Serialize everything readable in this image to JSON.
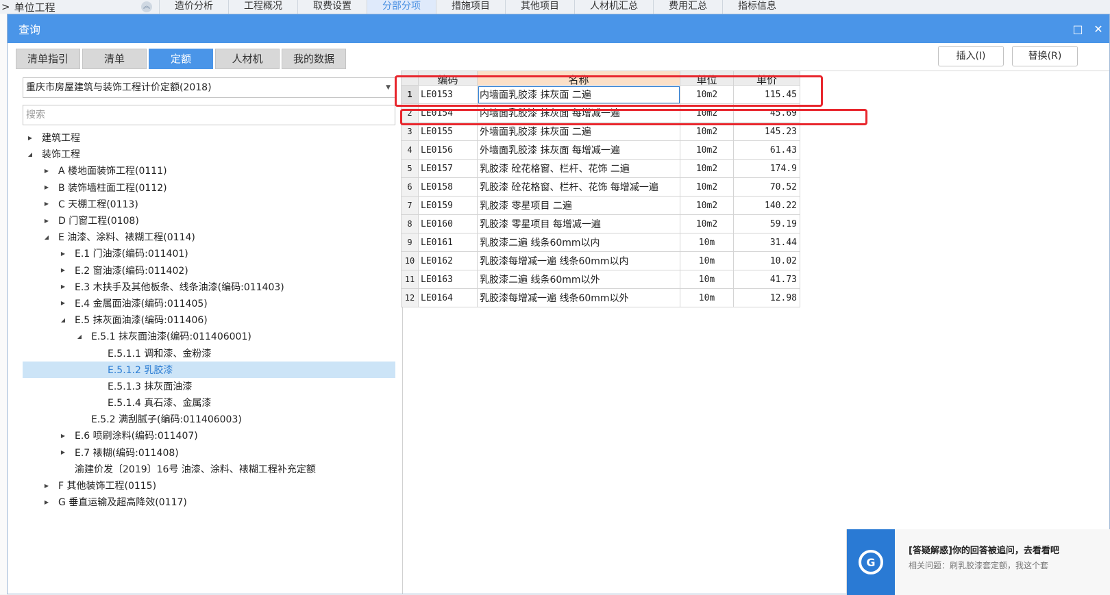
{
  "background": {
    "breadcrumb": "单位工程",
    "crumb_prefix": "> ",
    "tabs": [
      "造价分析",
      "工程概况",
      "取费设置",
      "分部分项",
      "措施项目",
      "其他项目",
      "人材机汇总",
      "费用汇总",
      "指标信息"
    ],
    "active_tab": "分部分项"
  },
  "dialog": {
    "title": "查询",
    "tabs": [
      "清单指引",
      "清单",
      "定额",
      "人材机",
      "我的数据"
    ],
    "active_tab": "定额",
    "insert_label": "插入(I)",
    "replace_label": "替换(R)"
  },
  "left": {
    "quota_lib": "重庆市房屋建筑与装饰工程计价定额(2018)",
    "search_placeholder": "搜索",
    "tree": [
      {
        "label": "建筑工程",
        "level": 0,
        "toggle": "collapsed"
      },
      {
        "label": "装饰工程",
        "level": 0,
        "toggle": "expanded"
      },
      {
        "label": "A 楼地面装饰工程(0111)",
        "level": 1,
        "toggle": "collapsed"
      },
      {
        "label": "B 装饰墙柱面工程(0112)",
        "level": 1,
        "toggle": "collapsed"
      },
      {
        "label": "C 天棚工程(0113)",
        "level": 1,
        "toggle": "collapsed"
      },
      {
        "label": "D 门窗工程(0108)",
        "level": 1,
        "toggle": "collapsed"
      },
      {
        "label": "E 油漆、涂料、裱糊工程(0114)",
        "level": 1,
        "toggle": "expanded"
      },
      {
        "label": "E.1 门油漆(编码:011401)",
        "level": 2,
        "toggle": "collapsed"
      },
      {
        "label": "E.2 窗油漆(编码:011402)",
        "level": 2,
        "toggle": "collapsed"
      },
      {
        "label": "E.3 木扶手及其他板条、线条油漆(编码:011403)",
        "level": 2,
        "toggle": "collapsed"
      },
      {
        "label": "E.4 金属面油漆(编码:011405)",
        "level": 2,
        "toggle": "collapsed"
      },
      {
        "label": "E.5 抹灰面油漆(编码:011406)",
        "level": 2,
        "toggle": "expanded"
      },
      {
        "label": "E.5.1 抹灰面油漆(编码:011406001)",
        "level": 3,
        "toggle": "expanded"
      },
      {
        "label": "E.5.1.1 调和漆、金粉漆",
        "level": 4,
        "toggle": "none"
      },
      {
        "label": "E.5.1.2 乳胶漆",
        "level": 4,
        "toggle": "none",
        "selected": true
      },
      {
        "label": "E.5.1.3 抹灰面油漆",
        "level": 4,
        "toggle": "none"
      },
      {
        "label": "E.5.1.4 真石漆、金属漆",
        "level": 4,
        "toggle": "none"
      },
      {
        "label": "E.5.2 满刮腻子(编码:011406003)",
        "level": 3,
        "toggle": "none"
      },
      {
        "label": "E.6 喷刷涂料(编码:011407)",
        "level": 2,
        "toggle": "collapsed"
      },
      {
        "label": "E.7 裱糊(编码:011408)",
        "level": 2,
        "toggle": "collapsed"
      },
      {
        "label": "渝建价发〔2019〕16号 油漆、涂料、裱糊工程补充定额",
        "level": 2,
        "toggle": "none"
      },
      {
        "label": "F 其他装饰工程(0115)",
        "level": 1,
        "toggle": "collapsed"
      },
      {
        "label": "G 垂直运输及超高降效(0117)",
        "level": 1,
        "toggle": "collapsed"
      }
    ]
  },
  "grid": {
    "headers": {
      "code": "编码",
      "name": "名称",
      "unit": "单位",
      "price": "单价"
    },
    "rows": [
      {
        "idx": "1",
        "code": "LE0153",
        "name": "内墙面乳胶漆 抹灰面 二遍",
        "unit": "10m2",
        "price": "115.45"
      },
      {
        "idx": "2",
        "code": "LE0154",
        "name": "内墙面乳胶漆 抹灰面 每增减一遍",
        "unit": "10m2",
        "price": "45.69"
      },
      {
        "idx": "3",
        "code": "LE0155",
        "name": "外墙面乳胶漆 抹灰面 二遍",
        "unit": "10m2",
        "price": "145.23"
      },
      {
        "idx": "4",
        "code": "LE0156",
        "name": "外墙面乳胶漆 抹灰面 每增减一遍",
        "unit": "10m2",
        "price": "61.43"
      },
      {
        "idx": "5",
        "code": "LE0157",
        "name": "乳胶漆 砼花格窗、栏杆、花饰 二遍",
        "unit": "10m2",
        "price": "174.9"
      },
      {
        "idx": "6",
        "code": "LE0158",
        "name": "乳胶漆 砼花格窗、栏杆、花饰 每增减一遍",
        "unit": "10m2",
        "price": "70.52"
      },
      {
        "idx": "7",
        "code": "LE0159",
        "name": "乳胶漆 零星项目 二遍",
        "unit": "10m2",
        "price": "140.22"
      },
      {
        "idx": "8",
        "code": "LE0160",
        "name": "乳胶漆 零星项目 每增减一遍",
        "unit": "10m2",
        "price": "59.19"
      },
      {
        "idx": "9",
        "code": "LE0161",
        "name": "乳胶漆二遍 线条60mm以内",
        "unit": "10m",
        "price": "31.44"
      },
      {
        "idx": "10",
        "code": "LE0162",
        "name": "乳胶漆每增减一遍 线条60mm以内",
        "unit": "10m",
        "price": "10.02"
      },
      {
        "idx": "11",
        "code": "LE0163",
        "name": "乳胶漆二遍 线条60mm以外",
        "unit": "10m",
        "price": "41.73"
      },
      {
        "idx": "12",
        "code": "LE0164",
        "name": "乳胶漆每增减一遍 线条60mm以外",
        "unit": "10m",
        "price": "12.98"
      }
    ]
  },
  "notification": {
    "title": "[答疑解惑]你的回答被追问，去看看吧",
    "body": "相关问题：刷乳胶漆套定额，我这个套"
  },
  "colors": {
    "accent": "#4a95e8",
    "highlight": "#e8262d",
    "selected_row": "#cce4f7"
  }
}
